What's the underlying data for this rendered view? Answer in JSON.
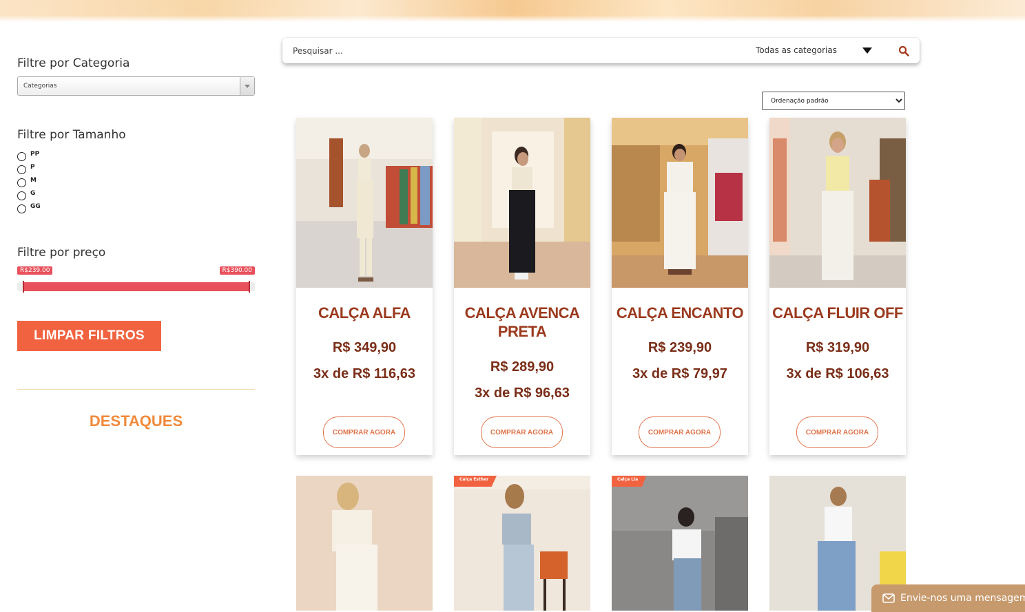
{
  "sidebar": {
    "category_title": "Filtre por Categoria",
    "category_select": "Categorias",
    "size_title": "Filtre por Tamanho",
    "sizes": [
      "PP",
      "P",
      "M",
      "G",
      "GG"
    ],
    "price_title": "Filtre por preço",
    "price_min": "R$239.00",
    "price_max": "R$390.00",
    "clear_button": "LIMPAR FILTROS",
    "highlights_title": "DESTAQUES"
  },
  "search": {
    "placeholder": "Pesquisar ...",
    "category": "Todas as categorias"
  },
  "sort": {
    "selected": "Ordenação padrão"
  },
  "products": [
    {
      "name": "CALÇA ALFA",
      "price": "R$ 349,90",
      "installments": "3x de R$ 116,63",
      "button": "COMPRAR AGORA"
    },
    {
      "name": "CALÇA AVENCA PRETA",
      "price": "R$ 289,90",
      "installments": "3x de R$ 96,63",
      "button": "COMPRAR AGORA"
    },
    {
      "name": "CALÇA ENCANTO",
      "price": "R$ 239,90",
      "installments": "3x de R$ 79,97",
      "button": "COMPRAR AGORA"
    },
    {
      "name": "CALÇA FLUIR OFF",
      "price": "R$ 319,90",
      "installments": "3x de R$ 106,63",
      "button": "COMPRAR AGORA"
    }
  ],
  "second_row": [
    {
      "badge": ""
    },
    {
      "badge": "Calça Esther"
    },
    {
      "badge": "Calça Lia"
    },
    {
      "badge": ""
    }
  ],
  "chat": {
    "label": "Envie-nos uma mensagem"
  },
  "colors": {
    "accent": "#f16340",
    "product_name": "#9b3a1e",
    "price_slider": "#e8505b",
    "highlights": "#f08a3c",
    "chat_bg": "#c79a6d"
  }
}
